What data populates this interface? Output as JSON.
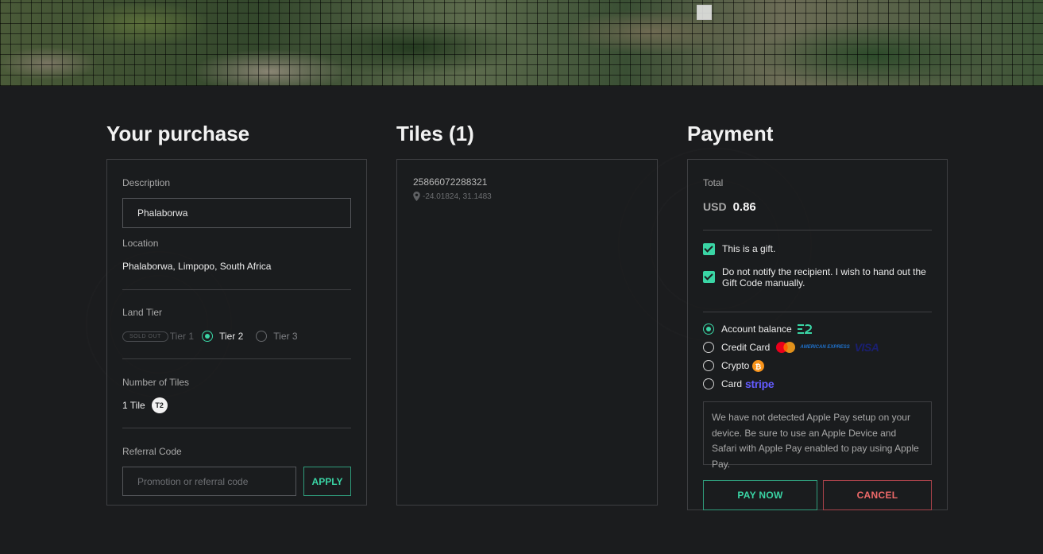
{
  "purchase": {
    "title": "Your purchase",
    "description_label": "Description",
    "description_value": "Phalaborwa",
    "location_label": "Location",
    "location_value": "Phalaborwa, Limpopo, South Africa",
    "land_tier_label": "Land Tier",
    "sold_out_badge": "SOLD OUT",
    "tiers": [
      "Tier 1",
      "Tier 2",
      "Tier 3"
    ],
    "selected_tier": "Tier 2",
    "tiles_label": "Number of Tiles",
    "tiles_value": "1 Tile",
    "tile_badge": "T2",
    "referral_label": "Referral Code",
    "referral_placeholder": "Promotion or referral code",
    "apply_label": "APPLY"
  },
  "tiles": {
    "title": "Tiles (1)",
    "items": [
      {
        "id": "25866072288321",
        "coords": "-24.01824, 31.1483"
      }
    ]
  },
  "payment": {
    "title": "Payment",
    "total_label": "Total",
    "currency": "USD",
    "amount": "0.86",
    "gift_label": "This is a gift.",
    "no_notify_label": "Do not notify the recipient. I wish to hand out the Gift Code manually.",
    "methods": [
      {
        "label": "Account balance",
        "selected": true
      },
      {
        "label": "Credit Card",
        "selected": false
      },
      {
        "label": "Crypto",
        "selected": false
      },
      {
        "label": "Card",
        "selected": false
      }
    ],
    "brand_amex": "AMERICAN EXPRESS",
    "brand_visa": "VISA",
    "brand_stripe": "stripe",
    "apple_pay_note": "We have not detected Apple Pay setup on your device. Be sure to use an Apple Device and Safari with Apple Pay enabled to pay using Apple Pay.",
    "pay_now_label": "PAY NOW",
    "cancel_label": "CANCEL"
  },
  "colors": {
    "accent": "#3ad5a5",
    "danger": "#f06a6a",
    "background": "#1b1c1e"
  }
}
